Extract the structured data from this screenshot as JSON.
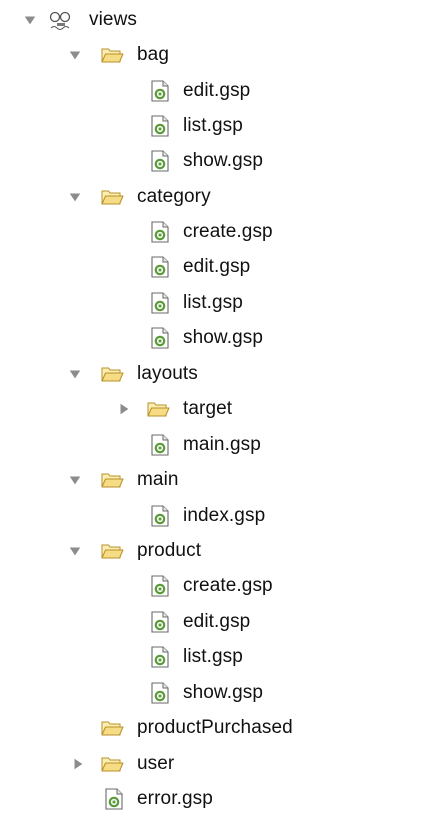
{
  "tree": {
    "root_label": "views",
    "bag": {
      "label": "bag",
      "files": [
        "edit.gsp",
        "list.gsp",
        "show.gsp"
      ]
    },
    "category": {
      "label": "category",
      "files": [
        "create.gsp",
        "edit.gsp",
        "list.gsp",
        "show.gsp"
      ]
    },
    "layouts": {
      "label": "layouts",
      "target_label": "target",
      "files": [
        "main.gsp"
      ]
    },
    "main": {
      "label": "main",
      "files": [
        "index.gsp"
      ]
    },
    "product": {
      "label": "product",
      "files": [
        "create.gsp",
        "edit.gsp",
        "list.gsp",
        "show.gsp"
      ]
    },
    "productPurchased_label": "productPurchased",
    "user_label": "user",
    "error_file": "error.gsp"
  },
  "icons": {
    "expanded": "triangle-down",
    "collapsed": "triangle-right",
    "folder": "open-folder-icon",
    "file": "gsp-file-icon",
    "root": "views-icon"
  },
  "colors": {
    "twisty": "#8c8c8c",
    "folder_fill": "#f5e08a",
    "folder_stroke": "#b8902a",
    "file_green": "#5a9a38"
  }
}
